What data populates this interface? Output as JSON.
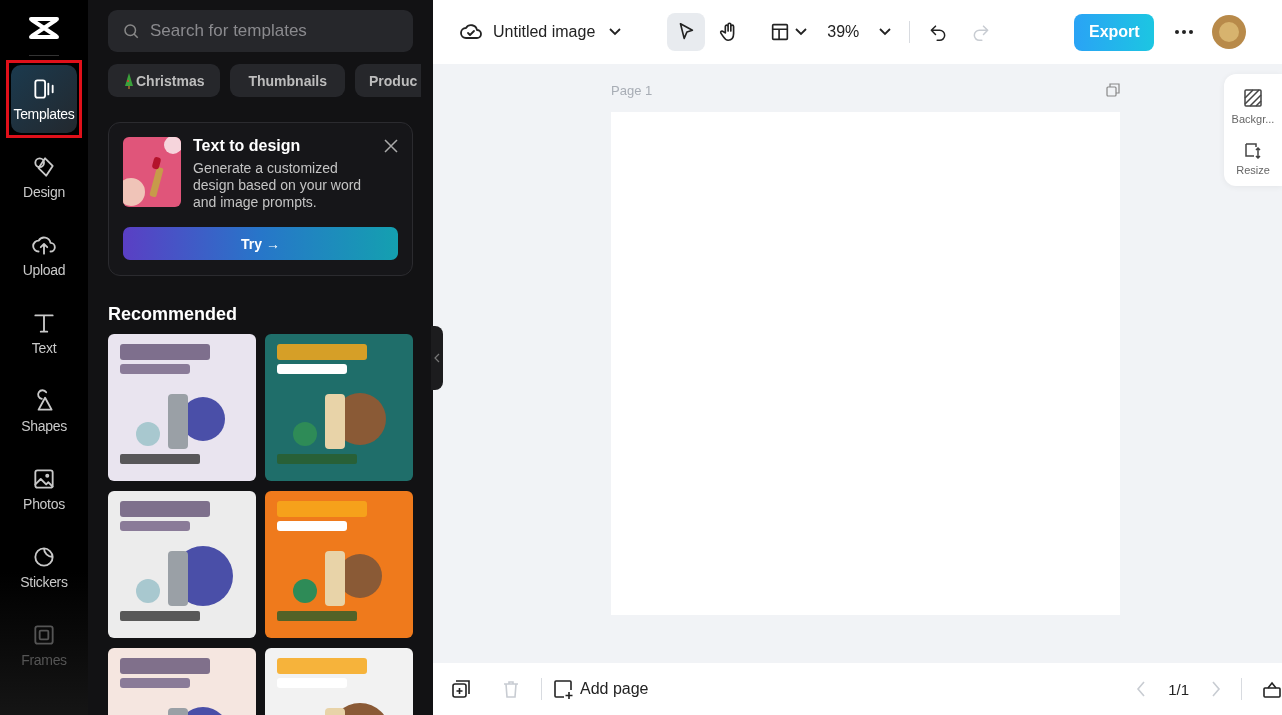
{
  "rail": {
    "items": [
      {
        "label": "Templates",
        "selected": true,
        "highlighted": true
      },
      {
        "label": "Design",
        "selected": false,
        "highlighted": false
      },
      {
        "label": "Upload",
        "selected": false,
        "highlighted": false
      },
      {
        "label": "Text",
        "selected": false,
        "highlighted": false
      },
      {
        "label": "Shapes",
        "selected": false,
        "highlighted": false
      },
      {
        "label": "Photos",
        "selected": false,
        "highlighted": false
      },
      {
        "label": "Stickers",
        "selected": false,
        "highlighted": false
      },
      {
        "label": "Frames",
        "selected": false,
        "highlighted": false
      }
    ]
  },
  "panel": {
    "search": {
      "placeholder": "Search for templates"
    },
    "chips": [
      {
        "label": "Christmas"
      },
      {
        "label": "Thumbnails"
      },
      {
        "label": "Produc"
      }
    ],
    "promo": {
      "title": "Text to design",
      "body": "Generate a customized design based on your word and image prompts.",
      "button": "Try →"
    },
    "section_title": "Recommended"
  },
  "topbar": {
    "title": "Untitled image",
    "tools": [
      {
        "selected": true
      },
      {
        "selected": false
      }
    ],
    "zoom": "39%",
    "history": [
      {
        "disabled": false
      },
      {
        "disabled": true
      }
    ],
    "export": "Export"
  },
  "canvas": {
    "page_label": "Page 1"
  },
  "side_tools": [
    {
      "label": "Backgr..."
    },
    {
      "label": "Resize"
    }
  ],
  "bottombar": {
    "add_page": "Add page",
    "pager": "1/1",
    "prev_disabled": true,
    "next_disabled": true,
    "delete_disabled": true
  }
}
